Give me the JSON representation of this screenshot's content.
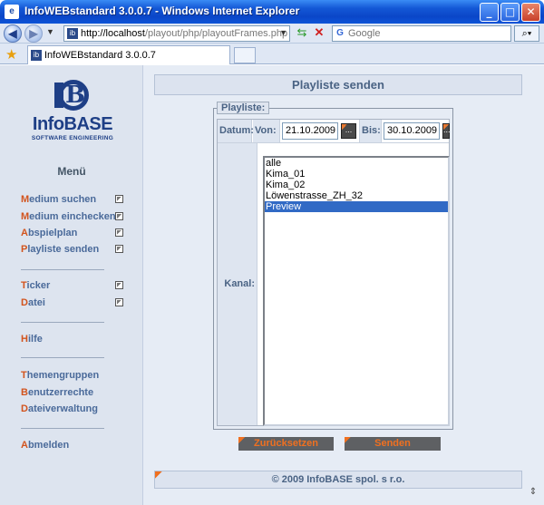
{
  "window": {
    "title": "InfoWEBstandard 3.0.0.7 - Windows Internet Explorer",
    "buttons": {
      "minimize": "_",
      "maximize": "□",
      "close": "✕"
    }
  },
  "address": {
    "url_host": "http://localhost",
    "url_path": "/playout/php/playoutFrames.php",
    "search_placeholder": "Google"
  },
  "tab": {
    "title": "InfoWEBstandard 3.0.0.7"
  },
  "logo": {
    "name": "InfoBASE",
    "tagline": "SOFTWARE ENGINEERING",
    "letter": "B"
  },
  "sidebar": {
    "title": "Menü",
    "groups": [
      [
        {
          "first": "M",
          "rest": "edium suchen",
          "checkbox": true
        },
        {
          "first": "M",
          "rest": "edium einchecken",
          "checkbox": true
        },
        {
          "first": "A",
          "rest": "bspielplan",
          "checkbox": true
        },
        {
          "first": "P",
          "rest": "layliste senden",
          "checkbox": true
        }
      ],
      [
        {
          "first": "T",
          "rest": "icker",
          "checkbox": true
        },
        {
          "first": "D",
          "rest": "atei",
          "checkbox": true
        }
      ],
      [
        {
          "first": "H",
          "rest": "ilfe",
          "checkbox": false
        }
      ],
      [
        {
          "first": "T",
          "rest": "hemengruppen",
          "checkbox": false
        },
        {
          "first": "B",
          "rest": "enutzerrechte",
          "checkbox": false
        },
        {
          "first": "D",
          "rest": "ateiverwaltung",
          "checkbox": false
        }
      ],
      [
        {
          "first": "A",
          "rest": "bmelden",
          "checkbox": false
        }
      ]
    ]
  },
  "main": {
    "header": "Playliste senden",
    "legend": "Playliste:",
    "datum_label": "Datum:",
    "von_label": "Von:",
    "von_value": "21.10.2009",
    "bis_label": "Bis:",
    "bis_value": "30.10.2009",
    "calendar_button": "...",
    "kanal_label": "Kanal:",
    "channels": [
      "alle",
      "Kima_01",
      "Kima_02",
      "Löwenstrasse_ZH_32",
      "Preview"
    ],
    "selected_channel": "Preview",
    "reset_button": "Zurücksetzen",
    "send_button": "Senden",
    "footer": "© 2009 InfoBASE spol. s r.o."
  },
  "colors": {
    "accent": "#f07020",
    "link": "#4a6a9a",
    "selection": "#316ac5",
    "titlebar": "#0a46c8"
  }
}
